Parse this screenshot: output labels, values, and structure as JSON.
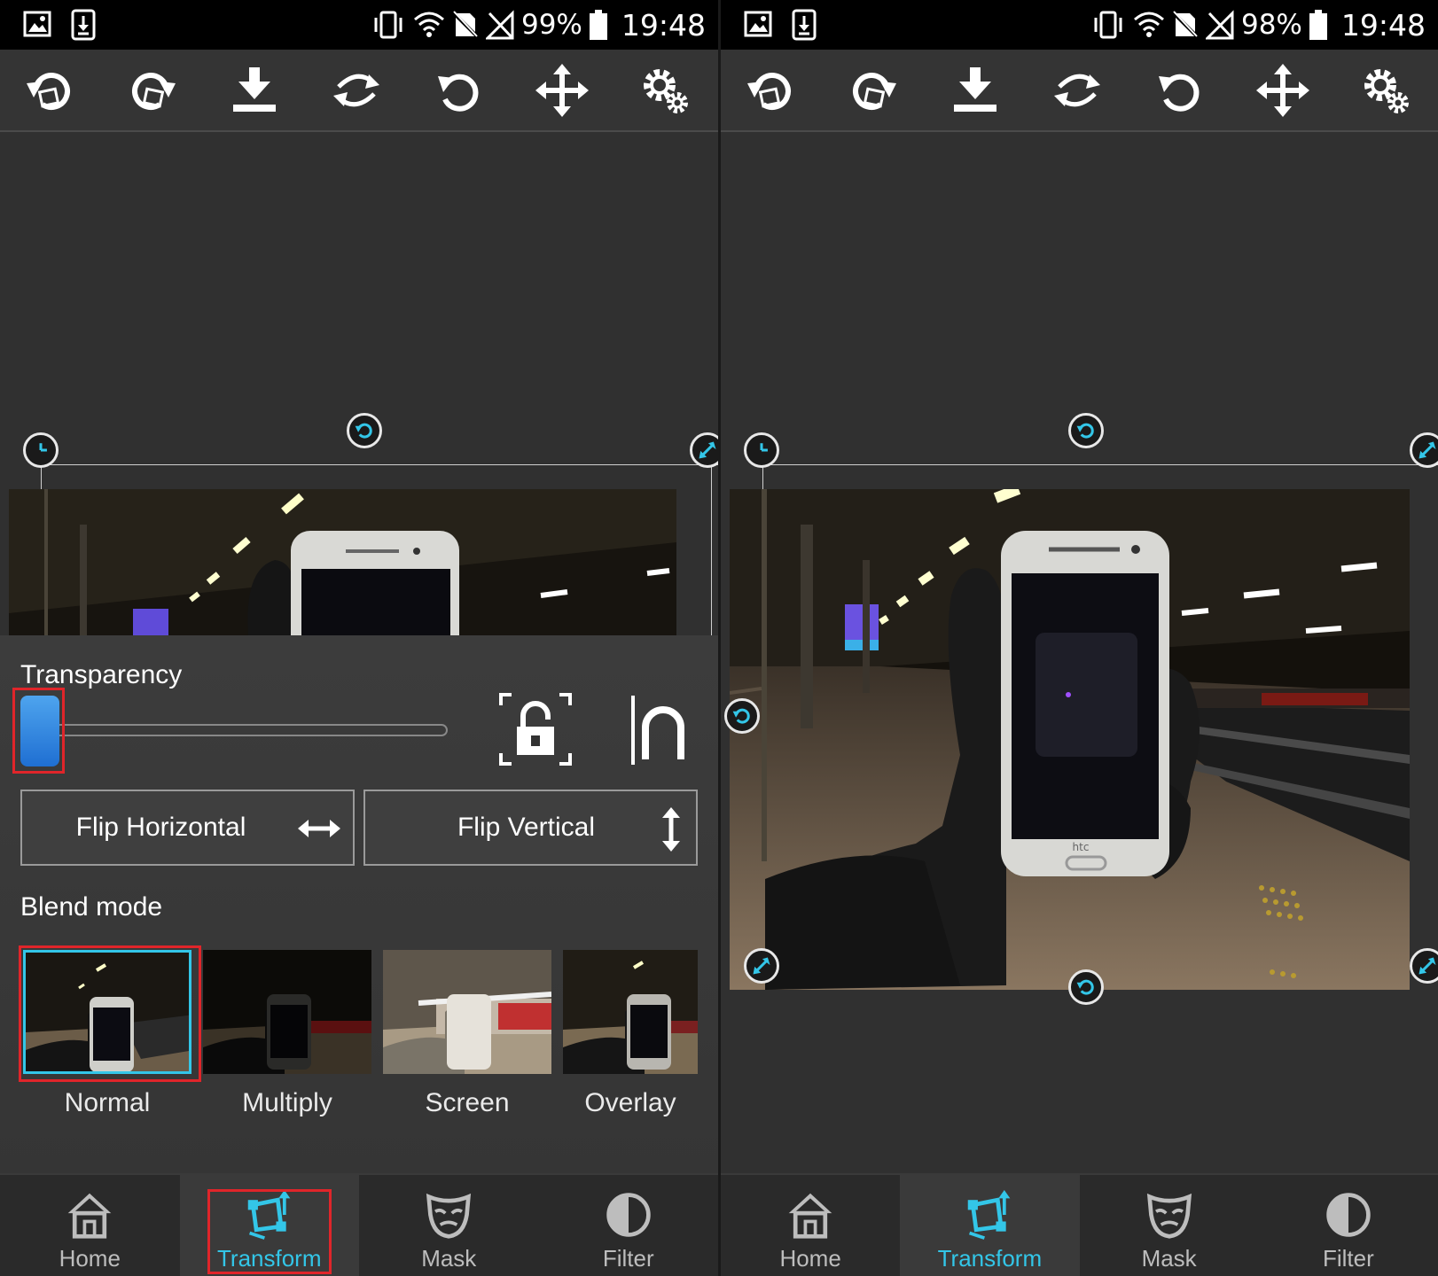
{
  "left_screen": {
    "status_bar": {
      "battery": "99%",
      "time": "19:48"
    },
    "toolbar": {
      "buttons": [
        "undo-icon",
        "redo-icon",
        "download-icon",
        "swap-icon",
        "rotate-icon",
        "move-icon",
        "settings-icon"
      ]
    },
    "panel": {
      "transparency_label": "Transparency",
      "transparency_value": 0,
      "flip_horizontal_label": "Flip Horizontal",
      "flip_vertical_label": "Flip Vertical",
      "blend_mode_label": "Blend mode",
      "blend_modes": [
        "Normal",
        "Multiply",
        "Screen",
        "Overlay"
      ],
      "selected_blend_mode": "Normal"
    },
    "bottom_nav": {
      "items": [
        "Home",
        "Transform",
        "Mask",
        "Filter"
      ],
      "active": "Transform"
    }
  },
  "right_screen": {
    "status_bar": {
      "battery": "98%",
      "time": "19:48"
    },
    "bottom_nav": {
      "items": [
        "Home",
        "Transform",
        "Mask",
        "Filter"
      ],
      "active": "Transform"
    },
    "photo": {
      "phone_brand_text": "htc"
    }
  },
  "colors": {
    "accent": "#33c6e8",
    "highlight_box": "#e0252a",
    "slider_thumb": "#2a84e0",
    "background": "#323232"
  }
}
